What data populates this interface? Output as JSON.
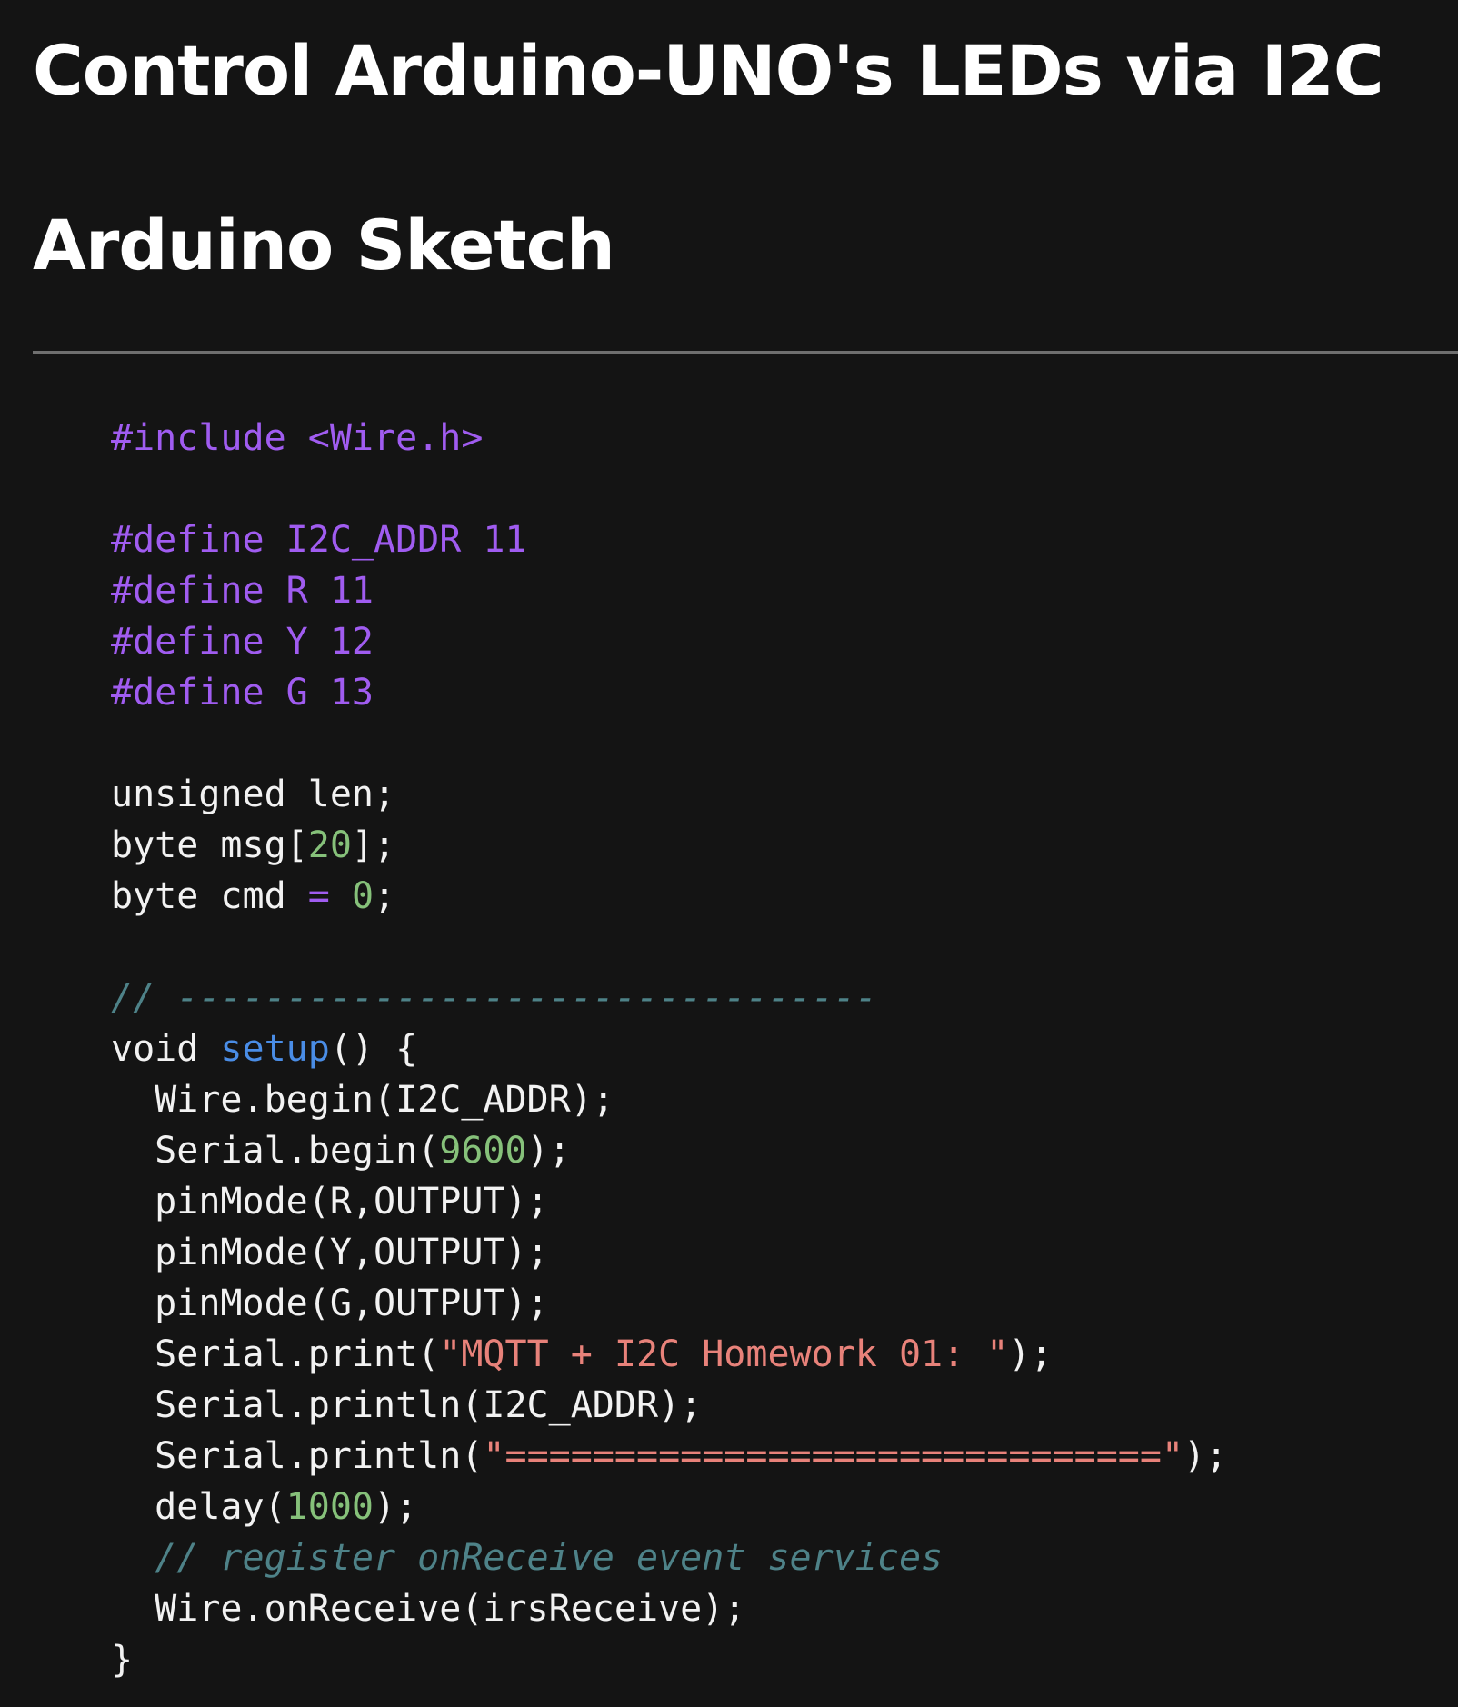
{
  "title": "Control Arduino-UNO's LEDs via I2C",
  "section_heading": "Arduino Sketch",
  "colors": {
    "background": "#141414",
    "preprocessor": "#a05cf0",
    "number": "#86c17a",
    "function_name": "#4a8de6",
    "string": "#e8827a",
    "comment": "#4e8288",
    "plain_text": "#f2f2f2"
  },
  "code": {
    "include": "#include <Wire.h>",
    "define_i2c": "#define I2C_ADDR 11",
    "define_r": "#define R 11",
    "define_y": "#define Y 12",
    "define_g": "#define G 13",
    "decl_len": "unsigned len;",
    "decl_msg_pre": "byte msg[",
    "decl_msg_num": "20",
    "decl_msg_post": "];",
    "decl_cmd_pre": "byte cmd ",
    "decl_cmd_op": "=",
    "decl_cmd_num": "0",
    "decl_cmd_post": ";",
    "divider_comment": "// --------------------------------",
    "setup_void": "void ",
    "setup_name": "setup",
    "setup_rest": "() {",
    "wire_begin": "  Wire.begin(I2C_ADDR);",
    "serial_begin_pre": "  Serial.begin(",
    "serial_begin_num": "9600",
    "serial_begin_post": ");",
    "pinmode_r": "  pinMode(R,OUTPUT);",
    "pinmode_y": "  pinMode(Y,OUTPUT);",
    "pinmode_g": "  pinMode(G,OUTPUT);",
    "print_pre": "  Serial.print(",
    "print_str": "\"MQTT + I2C Homework 01: \"",
    "print_post": ");",
    "println_addr": "  Serial.println(I2C_ADDR);",
    "println_eq_pre": "  Serial.println(",
    "println_eq_str": "\"==============================\"",
    "println_eq_post": ");",
    "delay_pre": "  delay(",
    "delay_num": "1000",
    "delay_post": ");",
    "register_comment": "  // register onReceive event services",
    "on_receive": "  Wire.onReceive(irsReceive);",
    "close_brace": "}"
  }
}
